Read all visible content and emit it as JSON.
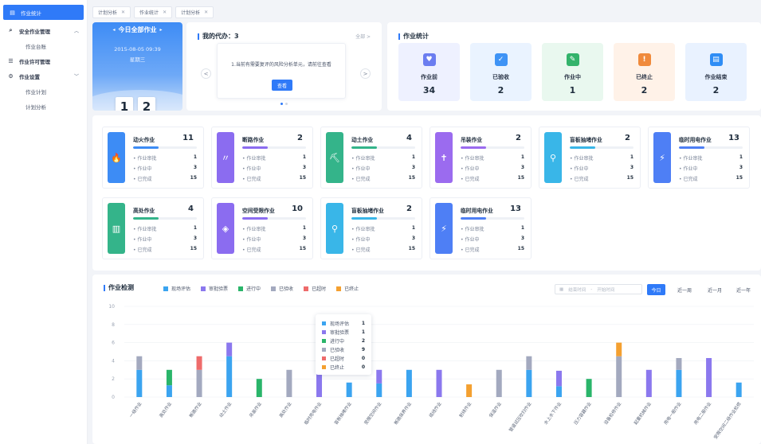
{
  "sidebar": {
    "items": [
      {
        "label": "作业统计",
        "icon": "chart-icon"
      },
      {
        "label": "安全作业管理",
        "icon": "search-doc-icon"
      },
      {
        "label": "作业台账",
        "icon": ""
      },
      {
        "label": "作业许可管理",
        "icon": "list-icon"
      },
      {
        "label": "作业设置",
        "icon": "gear-icon"
      },
      {
        "label": "作业计划",
        "icon": ""
      },
      {
        "label": "计划分析",
        "icon": ""
      }
    ]
  },
  "tabs": [
    "计划分析",
    "作业统计",
    "计划分析"
  ],
  "today": {
    "title": "今日全部作业",
    "datetime": "2015-08-05  09:39",
    "weekday": "星期三",
    "digits": [
      "1",
      "2"
    ]
  },
  "todo": {
    "title": "我的代办：3",
    "more": "全部 >",
    "message": "1.当前有需要复评的风险分析单元，请前往查看",
    "view_label": "查看",
    "prev": "<",
    "next": ">"
  },
  "stats": {
    "title": "作业统计",
    "cards": [
      {
        "label": "作业前",
        "value": "34",
        "color": "#6b7df0",
        "bg": "#eef1ff",
        "icon": "hands-icon",
        "glyph": "♥"
      },
      {
        "label": "已验收",
        "value": "2",
        "color": "#3f93f5",
        "bg": "#eaf3ff",
        "icon": "check-icon",
        "glyph": "✓"
      },
      {
        "label": "作业中",
        "value": "1",
        "color": "#33b36b",
        "bg": "#e9f8ef",
        "icon": "edit-icon",
        "glyph": "✎"
      },
      {
        "label": "已终止",
        "value": "2",
        "color": "#f08a3c",
        "bg": "#fff2e8",
        "icon": "warning-icon",
        "glyph": "!"
      },
      {
        "label": "作业结束",
        "value": "2",
        "color": "#2f8df5",
        "bg": "#e9f2ff",
        "icon": "doc-icon",
        "glyph": "▤"
      }
    ]
  },
  "work_types": {
    "row_labels": [
      "作业审批",
      "作业中",
      "已完成"
    ],
    "cards": [
      {
        "name": "动火作业",
        "count": "11",
        "vals": [
          "1",
          "3",
          "15"
        ],
        "color": "#3d8cf5",
        "icon": "fire-icon",
        "glyph": "🔥"
      },
      {
        "name": "断路作业",
        "count": "2",
        "vals": [
          "1",
          "3",
          "15"
        ],
        "color": "#8b6cf0",
        "icon": "road-icon",
        "glyph": "〃"
      },
      {
        "name": "动土作业",
        "count": "4",
        "vals": [
          "1",
          "3",
          "15"
        ],
        "color": "#34b48a",
        "icon": "shovel-icon",
        "glyph": "⛏"
      },
      {
        "name": "吊装作业",
        "count": "2",
        "vals": [
          "1",
          "3",
          "15"
        ],
        "color": "#9b6bef",
        "icon": "crane-icon",
        "glyph": "✝"
      },
      {
        "name": "盲板抽堵作业",
        "count": "2",
        "vals": [
          "1",
          "3",
          "15"
        ],
        "color": "#39b6e8",
        "icon": "valve-icon",
        "glyph": "⚲"
      },
      {
        "name": "临时用电作业",
        "count": "13",
        "vals": [
          "1",
          "3",
          "15"
        ],
        "color": "#4e7ff5",
        "icon": "plug-icon",
        "glyph": "⚡"
      },
      {
        "name": "高处作业",
        "count": "4",
        "vals": [
          "1",
          "3",
          "15"
        ],
        "color": "#34b48a",
        "icon": "building-icon",
        "glyph": "▥"
      },
      {
        "name": "空间受限作业",
        "count": "10",
        "vals": [
          "1",
          "3",
          "15"
        ],
        "color": "#8b6cf0",
        "icon": "box-icon",
        "glyph": "◈"
      },
      {
        "name": "盲板抽堵作业",
        "count": "2",
        "vals": [
          "1",
          "3",
          "15"
        ],
        "color": "#39b6e8",
        "icon": "valve-icon",
        "glyph": "⚲"
      },
      {
        "name": "临时用电作业",
        "count": "13",
        "vals": [
          "1",
          "3",
          "15"
        ],
        "color": "#4e7ff5",
        "icon": "plug-icon",
        "glyph": "⚡"
      }
    ]
  },
  "monitor": {
    "title": "作业检测",
    "date_start": "结束时间",
    "date_sep": "-",
    "date_end": "开始时间",
    "ranges": [
      "今日",
      "近一周",
      "近一月",
      "近一年"
    ],
    "tooltip": [
      {
        "label": "现场评估",
        "value": "1"
      },
      {
        "label": "审批验票",
        "value": "1"
      },
      {
        "label": "进行中",
        "value": "2"
      },
      {
        "label": "已验收",
        "value": "9"
      },
      {
        "label": "已超时",
        "value": "0"
      },
      {
        "label": "已终止",
        "value": "0"
      }
    ]
  },
  "chart_data": {
    "type": "bar",
    "stacked": true,
    "ylim": [
      0,
      10
    ],
    "yticks": [
      "0",
      "2",
      "4",
      "6",
      "8",
      "10"
    ],
    "legend_position": "top",
    "categories": [
      "一级作业",
      "高处作业",
      "断路作业",
      "动土作业",
      "吊装作业",
      "高处作业",
      "临时用电作业",
      "盲板抽堵作业",
      "受限空间作业",
      "断路保养作业",
      "缆线作业",
      "射线作业",
      "保温作业",
      "管道试压吹扫作业",
      "水上水下作业",
      "压力容器作业",
      "设备检修作业",
      "起重机械作业",
      "用电一般作业",
      "用电二般作业",
      "受限空间二级作业检修"
    ],
    "series": [
      {
        "name": "现场评估",
        "color": "#3ba4f0",
        "values": [
          3,
          1.3,
          0,
          4.5,
          0,
          0,
          0,
          1.6,
          1.5,
          3,
          0,
          0,
          0,
          3,
          1.2,
          0,
          0,
          0,
          3,
          0,
          1.6
        ]
      },
      {
        "name": "审批验票",
        "color": "#8b78ee",
        "values": [
          0,
          0,
          0,
          1.5,
          0,
          0,
          4.3,
          0,
          1.5,
          0,
          3,
          0,
          0,
          0,
          1.7,
          0,
          0,
          3,
          0,
          4.3,
          0
        ]
      },
      {
        "name": "进行中",
        "color": "#2ab56a",
        "values": [
          0,
          1.7,
          0,
          0,
          2,
          0,
          0,
          0,
          0,
          0,
          0,
          0,
          0,
          0,
          0,
          2,
          0,
          0,
          0,
          0,
          0
        ]
      },
      {
        "name": "已验收",
        "color": "#a3a9bf",
        "values": [
          1.5,
          0,
          3,
          0,
          0,
          3,
          0,
          0,
          0,
          0,
          0,
          0,
          3,
          1.5,
          0,
          0,
          4.5,
          0,
          1.3,
          0,
          0
        ]
      },
      {
        "name": "已超时",
        "color": "#ee6b6b",
        "values": [
          0,
          0,
          1.5,
          0,
          0,
          0,
          0,
          0,
          0,
          0,
          0,
          0,
          0,
          0,
          0,
          0,
          0,
          0,
          0,
          0,
          0
        ]
      },
      {
        "name": "已终止",
        "color": "#f4a030",
        "values": [
          0,
          0,
          0,
          0,
          0,
          0,
          0,
          0,
          0,
          0,
          0,
          1.4,
          0,
          0,
          0,
          0,
          1.5,
          0,
          0,
          0,
          0
        ]
      }
    ]
  }
}
